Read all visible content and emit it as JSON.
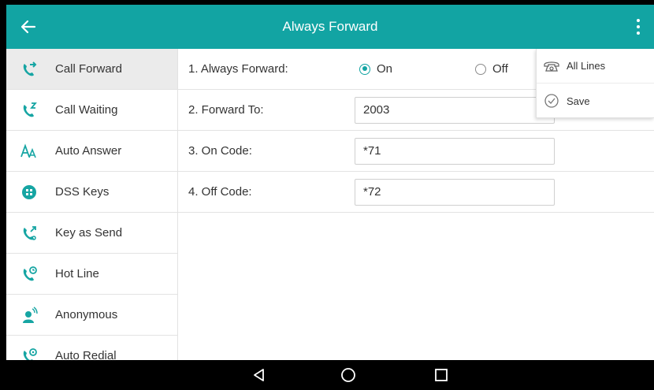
{
  "header": {
    "title": "Always Forward"
  },
  "sidebar": {
    "items": [
      {
        "label": "Call Forward",
        "icon": "call-forward-icon"
      },
      {
        "label": "Call Waiting",
        "icon": "call-waiting-icon"
      },
      {
        "label": "Auto Answer",
        "icon": "auto-answer-icon"
      },
      {
        "label": "DSS Keys",
        "icon": "dss-keys-icon"
      },
      {
        "label": "Key as Send",
        "icon": "key-as-send-icon"
      },
      {
        "label": "Hot Line",
        "icon": "hot-line-icon"
      },
      {
        "label": "Anonymous",
        "icon": "anonymous-icon"
      },
      {
        "label": "Auto Redial",
        "icon": "auto-redial-icon"
      }
    ]
  },
  "form": {
    "always_forward": {
      "label": "1. Always Forward:",
      "on_label": "On",
      "off_label": "Off",
      "selected": "On"
    },
    "forward_to": {
      "label": "2. Forward To:",
      "value": "2003"
    },
    "on_code": {
      "label": "3. On Code:",
      "value": "*71"
    },
    "off_code": {
      "label": "4. Off Code:",
      "value": "*72"
    }
  },
  "menu": {
    "items": [
      {
        "label": "All Lines",
        "icon": "phone-icon"
      },
      {
        "label": "Save",
        "icon": "check-circle-icon"
      }
    ]
  },
  "colors": {
    "accent": "#12a4a3",
    "navbar": "#000000"
  }
}
